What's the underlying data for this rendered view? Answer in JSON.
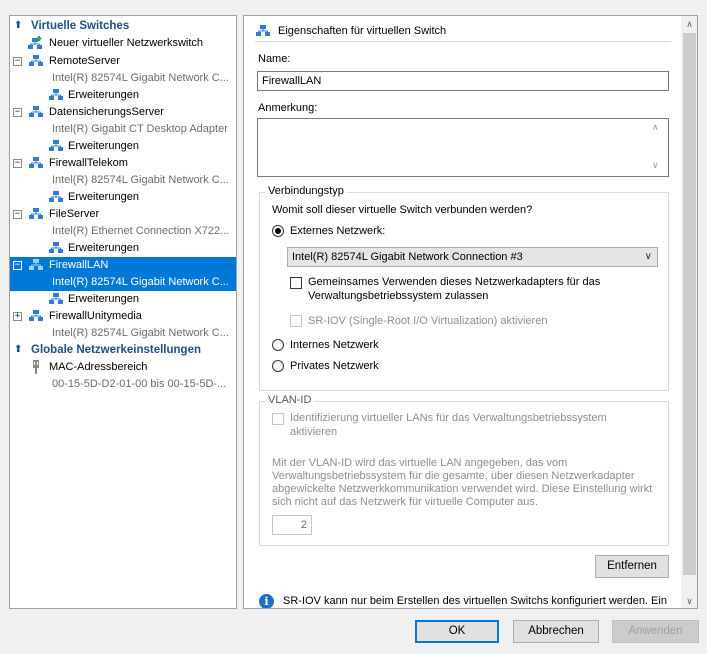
{
  "tree": {
    "section_switches": "Virtuelle Switches",
    "section_global": "Globale Netzwerkeinstellungen",
    "new_switch": "Neuer virtueller Netzwerkswitch",
    "switches": [
      {
        "name": "RemoteServer",
        "adapter": "Intel(R) 82574L Gigabit Network C...",
        "ext": "Erweiterungen"
      },
      {
        "name": "DatensicherungsServer",
        "adapter": "Intel(R) Gigabit CT Desktop Adapter",
        "ext": "Erweiterungen"
      },
      {
        "name": "FirewallTelekom",
        "adapter": "Intel(R) 82574L Gigabit Network C...",
        "ext": "Erweiterungen"
      },
      {
        "name": "FileServer",
        "adapter": "Intel(R) Ethernet Connection X722...",
        "ext": "Erweiterungen"
      },
      {
        "name": "FirewallLAN",
        "adapter": "Intel(R) 82574L Gigabit Network C...",
        "ext": "Erweiterungen"
      },
      {
        "name": "FirewallUnitymedia",
        "adapter": "Intel(R) 82574L Gigabit Network C..."
      }
    ],
    "mac": {
      "name": "MAC-Adressbereich",
      "range": "00-15-5D-D2-01-00 bis 00-15-5D-..."
    }
  },
  "props": {
    "title": "Eigenschaften für virtuellen Switch",
    "name_label": "Name:",
    "name_value": "FirewallLAN",
    "note_label": "Anmerkung:",
    "note_value": "",
    "conn_group": "Verbindungstyp",
    "conn_question": "Womit soll dieser virtuelle Switch verbunden werden?",
    "radio_external": "Externes Netzwerk:",
    "adapter_selected": "Intel(R) 82574L Gigabit Network Connection #3",
    "share_line1": "Gemeinsames Verwenden dieses Netzwerkadapters für das",
    "share_line2": "Verwaltungsbetriebssystem zulassen",
    "sriov": "SR-IOV (Single-Root I/O Virtualization) aktivieren",
    "radio_internal": "Internes Netzwerk",
    "radio_private": "Privates Netzwerk",
    "vlan_group": "VLAN-ID",
    "vlan_check_line1": "Identifizierung virtueller LANs für das Verwaltungsbetriebssystem",
    "vlan_check_line2": "aktivieren",
    "vlan_desc1": "Mit der VLAN-ID wird das virtuelle LAN angegeben, das vom",
    "vlan_desc2": "Verwaltungsbetriebssystem für die gesamte, über diesen Netzwerkadapter",
    "vlan_desc3": "abgewickelte Netzwerkkommunikation verwendet wird. Diese Einstellung wirkt",
    "vlan_desc4": "sich nicht auf das Netzwerk für virtuelle Computer aus.",
    "vlan_value": "2",
    "remove_button": "Entfernen",
    "info_text": "SR-IOV kann nur beim Erstellen des virtuellen Switchs konfiguriert werden. Ein"
  },
  "footer": {
    "ok": "OK",
    "cancel": "Abbrechen",
    "apply": "Anwenden"
  }
}
